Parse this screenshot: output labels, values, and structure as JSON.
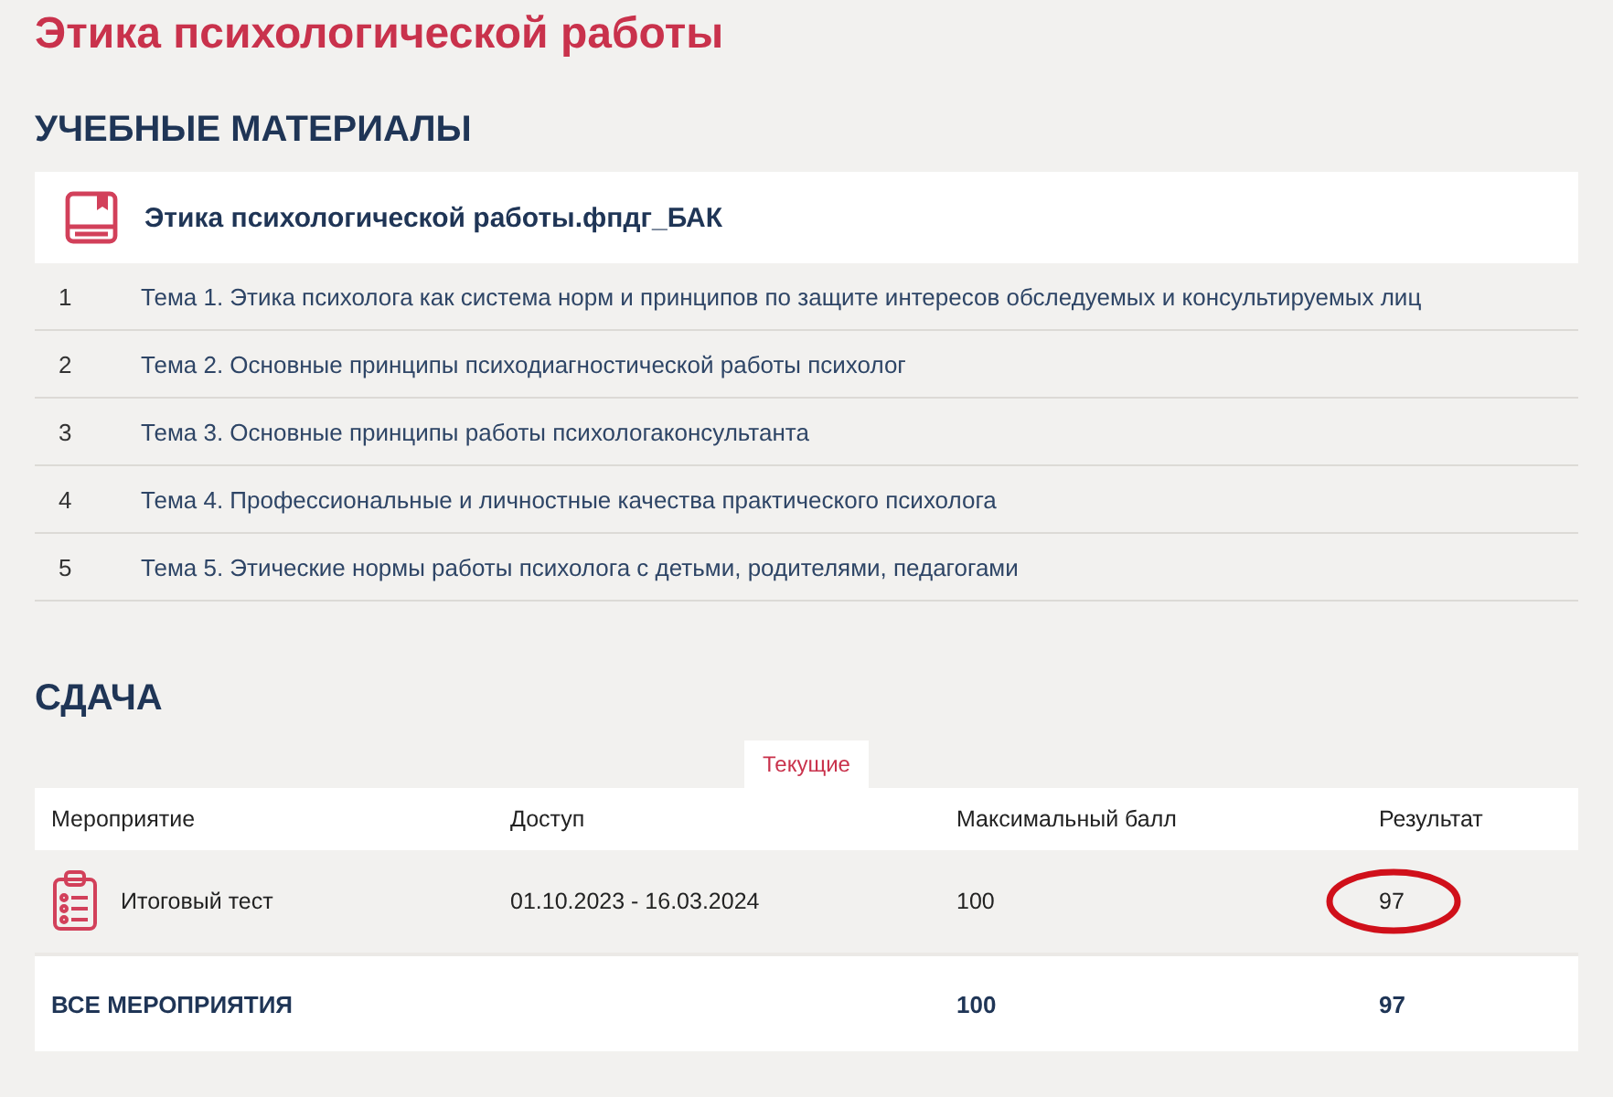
{
  "page_title": "Этика психологической работы",
  "materials": {
    "heading": "УЧЕБНЫЕ МАТЕРИАЛЫ",
    "file": "Этика психологической работы.фпдг_БАК",
    "topics": [
      {
        "number": "1",
        "title": "Тема 1. Этика психолога как система норм и принципов по защите интересов обследуемых и консультируемых лиц"
      },
      {
        "number": "2",
        "title": "Тема 2. Основные принципы психодиагностической работы психолог"
      },
      {
        "number": "3",
        "title": "Тема 3. Основные принципы работы психологаконсультанта"
      },
      {
        "number": "4",
        "title": "Тема 4. Профессиональные и личностные качества практического психолога"
      },
      {
        "number": "5",
        "title": "Тема 5. Этические нормы работы психолога с детьми, родителями, педагогами"
      }
    ]
  },
  "submission": {
    "heading": "СДАЧА",
    "tabs": [
      {
        "label": "Текущие",
        "selected": true
      }
    ],
    "table": {
      "columns": [
        "Мероприятие",
        "Доступ",
        "Максимальный балл",
        "Результат"
      ],
      "rows": [
        {
          "event": "Итоговый тест",
          "access": "01.10.2023 - 16.03.2024",
          "max_score": "100",
          "result": "97",
          "circled": true
        }
      ],
      "total": {
        "label": "ВСЕ МЕРОПРИЯТИЯ",
        "max_score": "100",
        "result": "97"
      }
    }
  }
}
